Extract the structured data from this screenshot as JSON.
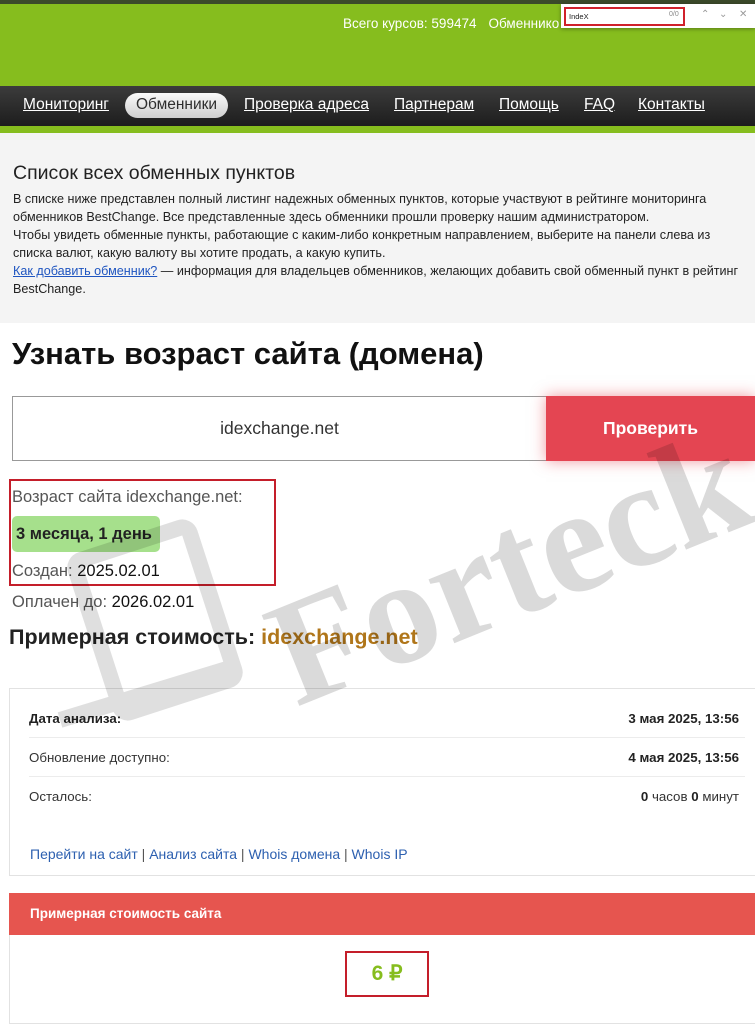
{
  "header": {
    "stats_label": "Всего курсов:",
    "stats_value": "599474",
    "exchangers_label": "Обменнико"
  },
  "findbar": {
    "query": "IndeX",
    "count": "0/0"
  },
  "nav": {
    "items": [
      "Мониторинг",
      "Обменники",
      "Проверка адреса",
      "Партнерам",
      "Помощь",
      "FAQ",
      "Контакты"
    ],
    "active": "Обменники"
  },
  "info": {
    "title": "Список всех обменных пунктов",
    "p1": "В списке ниже представлен полный листинг надежных обменных пунктов, которые участвуют в рейтинге мониторинга обменников BestChange. Все представленные здесь обменники прошли проверку нашим администратором.",
    "p2": "Чтобы увидеть обменные пункты, работающие с каким-либо конкретным направлением, выберите на панели слева из списка валют, какую валюту вы хотите продать, а какую купить.",
    "link": "Как добавить обменник?",
    "p3": " — информация для владельцев обменников, желающих добавить свой обменный пункт в рейтинг BestChange."
  },
  "age": {
    "title": "Узнать возраст сайта (домена)",
    "input_value": "idexchange.net",
    "button": "Проверить",
    "label": "Возраст сайта idexchange.net:",
    "age_value": "3 месяца, 1 день",
    "created_label": "Создан:",
    "created_value": "2025.02.01",
    "paid_label": "Оплачен до:",
    "paid_value": "2026.02.01"
  },
  "cost": {
    "title_prefix": "Примерная стоимость:",
    "domain": "idexchange.net",
    "rows": [
      {
        "label": "Дата анализа:",
        "value": "3 мая 2025, 13:56"
      },
      {
        "label": "Обновление доступно:",
        "value": "4 мая 2025, 13:56"
      }
    ],
    "remaining_label": "Осталось:",
    "remaining_hours": "0",
    "hours_word": "часов",
    "remaining_minutes": "0",
    "minutes_word": "минут",
    "links": [
      "Перейти на сайт",
      "Анализ сайта",
      "Whois домена",
      "Whois IP"
    ],
    "link_sep": " | ",
    "site_cost_header": "Примерная стоимость сайта",
    "site_cost_value": "6 ₽"
  },
  "watermark": {
    "text": "Forteck"
  },
  "colors": {
    "header_green": "#86bd1e",
    "button_red": "#e44552",
    "cost_header_red": "#e6554f",
    "domain_gold": "#b0761a",
    "link_blue": "#2d60b0",
    "annotation_red": "#c41e2a"
  }
}
